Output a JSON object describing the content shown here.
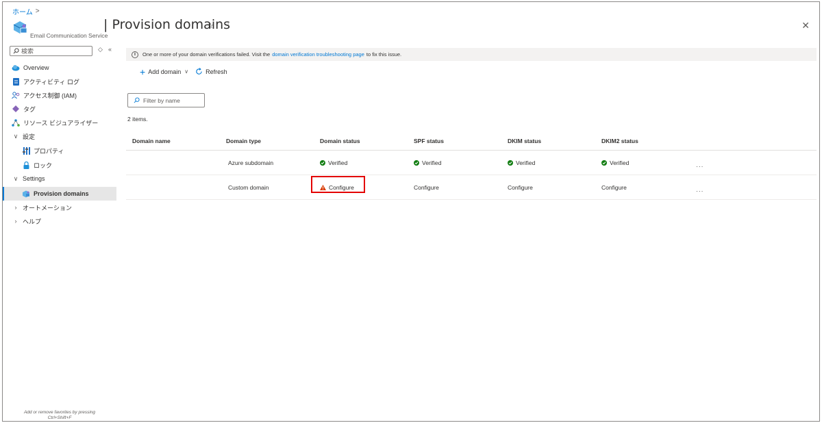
{
  "breadcrumb": {
    "home": "ホーム",
    "sep": ">"
  },
  "header": {
    "title": "| Provision domains",
    "subtitle": "Email Communication Service",
    "star": "☆",
    "more": "···",
    "close": "✕"
  },
  "sidebar": {
    "search_placeholder": "検索",
    "controls": {
      "toggle": "◇",
      "collapse": "«"
    },
    "items": [
      {
        "label": "Overview",
        "icon": "cloud-icon"
      },
      {
        "label": "アクティビティ ログ",
        "icon": "activity-log-icon"
      },
      {
        "label": "アクセス制御 (IAM)",
        "icon": "iam-icon"
      },
      {
        "label": "タグ",
        "icon": "tag-icon"
      },
      {
        "label": "リソース ビジュアライザー",
        "icon": "visualizer-icon"
      },
      {
        "label": "設定",
        "icon": "chevron-down-icon",
        "group": true
      },
      {
        "label": "プロパティ",
        "icon": "properties-icon"
      },
      {
        "label": "ロック",
        "icon": "lock-icon"
      },
      {
        "label": "Settings",
        "icon": "chevron-down-icon",
        "group": true
      },
      {
        "label": "Provision domains",
        "icon": "domain-icon",
        "active": true
      },
      {
        "label": "オートメーション",
        "icon": "chevron-right-icon",
        "group": true
      },
      {
        "label": "ヘルプ",
        "icon": "chevron-right-icon",
        "group": true
      }
    ],
    "favorites_hint_1": "Add or remove favorites by pressing",
    "favorites_hint_2": "Ctrl+Shift+F"
  },
  "banner": {
    "text_before": "One or more of your domain verifications failed. Visit the",
    "link": "domain verification troubleshooting page",
    "text_after": "to fix this issue."
  },
  "toolbar": {
    "add_domain": "Add domain",
    "refresh": "Refresh"
  },
  "filter": {
    "placeholder": "Filter by name"
  },
  "count_text": "2 items.",
  "table": {
    "columns": [
      "Domain name",
      "Domain type",
      "Domain status",
      "SPF status",
      "DKIM status",
      "DKIM2 status"
    ],
    "rows": [
      {
        "domain_name": "",
        "domain_type": "Azure subdomain",
        "domain_status": "Verified",
        "spf": "Verified",
        "dkim": "Verified",
        "dkim2": "Verified",
        "more": "···"
      },
      {
        "domain_name": "",
        "domain_type": "Custom domain",
        "domain_status": "Configure",
        "spf": "Configure",
        "dkim": "Configure",
        "dkim2": "Configure",
        "more": "···"
      }
    ]
  },
  "colors": {
    "accent": "#0078d4",
    "success": "#107c10",
    "warning": "#d83b01",
    "highlight": "#e30000"
  }
}
